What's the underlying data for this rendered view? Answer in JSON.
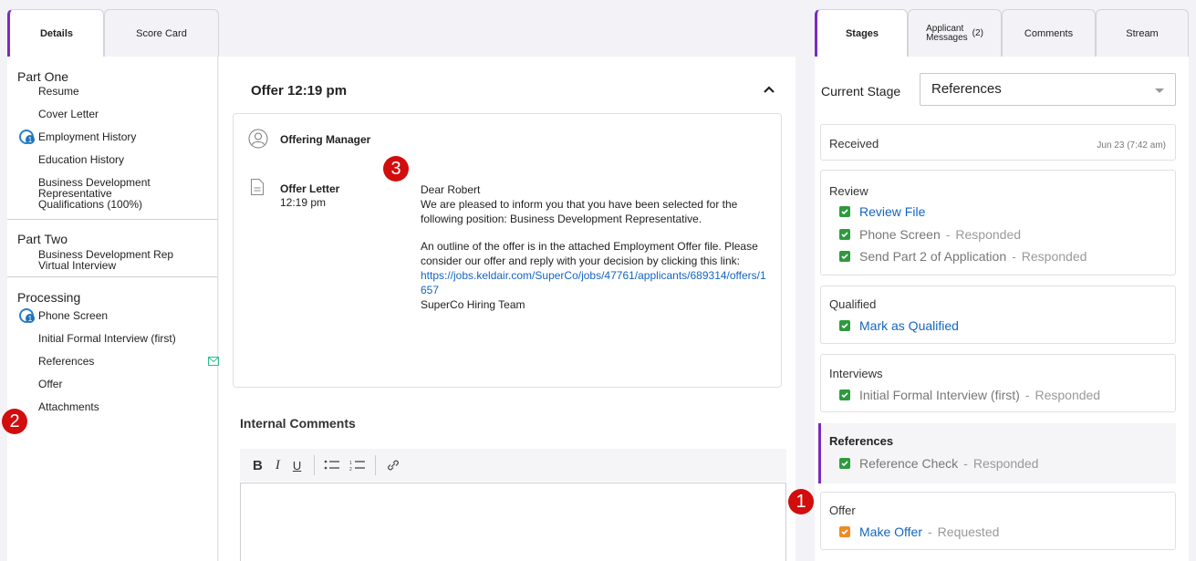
{
  "left_tabs": [
    {
      "label": "Details"
    },
    {
      "label": "Score Card"
    }
  ],
  "left_panel": {
    "part_one": {
      "title": "Part One",
      "items": [
        "Resume",
        "Cover Letter",
        "Employment History",
        "Education History",
        "Business Development Representative Qualifications (100%)"
      ]
    },
    "part_two": {
      "title": "Part Two",
      "items": [
        "Business Development Rep Virtual Interview"
      ]
    },
    "processing": {
      "title": "Processing",
      "items": [
        "Phone Screen",
        "Initial Formal Interview (first)",
        "References",
        "Offer",
        "Attachments"
      ]
    }
  },
  "badges": {
    "one": "1",
    "two": "2",
    "three": "3"
  },
  "center": {
    "offer_title": "Offer 12:19 pm",
    "offering_manager": "Offering Manager",
    "offer_letter_label": "Offer Letter",
    "offer_letter_time": "12:19 pm",
    "message": {
      "greeting": "Dear Robert",
      "para1": "We are pleased to inform you that you have been selected for the following position: Business Development Representative.",
      "para2": "An outline of the offer is in the attached Employment Offer file. Please consider our offer and reply with your decision by clicking this link:",
      "link": "https://jobs.keldair.com/SuperCo/jobs/47761/applicants/689314/offers/1657",
      "signature": "SuperCo Hiring Team"
    },
    "internal_comments_title": "Internal Comments",
    "toolbar": {
      "bold": "B",
      "italic": "I",
      "underline": "U"
    }
  },
  "right_tabs": [
    {
      "label": "Stages"
    },
    {
      "label_line1": "Applicant",
      "label_line2": "Messages",
      "count": "(2)"
    },
    {
      "label": "Comments"
    },
    {
      "label": "Stream"
    }
  ],
  "right_panel": {
    "current_stage_label": "Current Stage",
    "current_stage_value": "References",
    "stages": {
      "received": {
        "name": "Received",
        "date": "Jun 23 (7:42 am)"
      },
      "review": {
        "name": "Review",
        "tasks": [
          {
            "label": "Review File",
            "status": ""
          },
          {
            "label": "Phone Screen",
            "status": "Responded"
          },
          {
            "label": "Send Part 2 of Application",
            "status": "Responded"
          }
        ]
      },
      "qualified": {
        "name": "Qualified",
        "tasks": [
          {
            "label": "Mark as Qualified",
            "status": ""
          }
        ]
      },
      "interviews": {
        "name": "Interviews",
        "tasks": [
          {
            "label": "Initial Formal Interview (first)",
            "status": "Responded"
          }
        ]
      },
      "references": {
        "name": "References",
        "tasks": [
          {
            "label": "Reference Check",
            "status": "Responded"
          }
        ]
      },
      "offer": {
        "name": "Offer",
        "tasks": [
          {
            "label": "Make Offer",
            "status": "Requested"
          }
        ]
      }
    },
    "separator": "-"
  },
  "colors": {
    "accent": "#7a2bc0",
    "link": "#1565c0",
    "badge": "#d10d0d",
    "check_green": "#2e9a3e",
    "check_orange": "#f08a24"
  }
}
